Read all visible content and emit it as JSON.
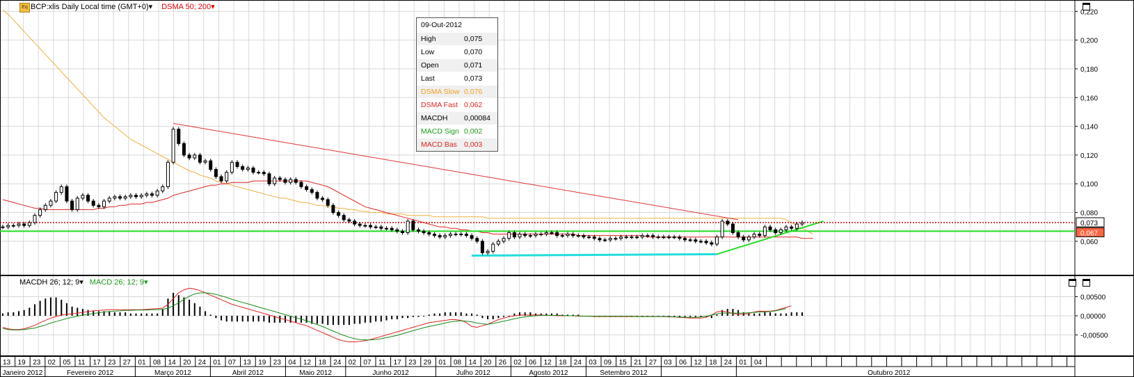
{
  "header": {
    "instrument": "BCP:xlis Daily Local time (GMT+0)",
    "indicator": "DSMA 50; 200",
    "logo_text": "Eq"
  },
  "macd_header": {
    "macdh": "MACDH 26; 12; 9",
    "macd": "MACD 26; 12; 9"
  },
  "infobox": {
    "date": "09-Out-2012",
    "rows": [
      {
        "k": "High",
        "v": "0,075",
        "color": "#000000"
      },
      {
        "k": "Low",
        "v": "0,070",
        "color": "#000000"
      },
      {
        "k": "Open",
        "v": "0,071",
        "color": "#000000"
      },
      {
        "k": "Last",
        "v": "0,073",
        "color": "#000000"
      },
      {
        "k": "DSMA Slow",
        "v": "0,076",
        "color": "#f0a020"
      },
      {
        "k": "DSMA Fast",
        "v": "0,062",
        "color": "#dd2222"
      },
      {
        "k": "MACDH",
        "v": "0,00084",
        "color": "#000000"
      },
      {
        "k": "MACD Sign",
        "v": "0,002",
        "color": "#1a9a1a"
      },
      {
        "k": "MACD Bas",
        "v": "0,003",
        "color": "#dd2222"
      }
    ]
  },
  "colors": {
    "slow_ma": "#f0b040",
    "fast_ma": "#dd2222",
    "support": "#22dd22",
    "low_line": "#22dddd",
    "trendline": "#dd3333",
    "last_price": "#cc0000",
    "support_label_bg": "#ff6644"
  },
  "chart_data": [
    {
      "type": "candlestick",
      "title": "BCP:xlis Daily Local time (GMT+0)",
      "ylim": [
        0.043,
        0.225
      ],
      "y_ticks": [
        "0,060",
        "0,080",
        "0,100",
        "0,120",
        "0,140",
        "0,160",
        "0,180",
        "0,200",
        "0,220"
      ],
      "y_tick_values": [
        0.06,
        0.08,
        0.1,
        0.12,
        0.14,
        0.16,
        0.18,
        0.2,
        0.22
      ],
      "last_price_label": "0,073",
      "last_price": 0.073,
      "support_label": "0,067",
      "support": 0.067,
      "closes": [
        0.07,
        0.071,
        0.071,
        0.072,
        0.071,
        0.073,
        0.078,
        0.082,
        0.085,
        0.088,
        0.094,
        0.098,
        0.088,
        0.082,
        0.09,
        0.092,
        0.088,
        0.085,
        0.084,
        0.088,
        0.09,
        0.091,
        0.09,
        0.091,
        0.092,
        0.091,
        0.092,
        0.093,
        0.092,
        0.095,
        0.098,
        0.115,
        0.138,
        0.128,
        0.12,
        0.118,
        0.12,
        0.115,
        0.116,
        0.11,
        0.105,
        0.102,
        0.108,
        0.115,
        0.112,
        0.11,
        0.111,
        0.108,
        0.108,
        0.107,
        0.1,
        0.104,
        0.103,
        0.101,
        0.103,
        0.101,
        0.098,
        0.096,
        0.094,
        0.09,
        0.089,
        0.085,
        0.08,
        0.078,
        0.075,
        0.074,
        0.072,
        0.071,
        0.071,
        0.07,
        0.07,
        0.069,
        0.069,
        0.068,
        0.067,
        0.066,
        0.074,
        0.068,
        0.067,
        0.066,
        0.065,
        0.064,
        0.063,
        0.064,
        0.065,
        0.065,
        0.065,
        0.064,
        0.062,
        0.06,
        0.052,
        0.053,
        0.058,
        0.06,
        0.062,
        0.066,
        0.063,
        0.065,
        0.064,
        0.064,
        0.065,
        0.065,
        0.066,
        0.066,
        0.064,
        0.064,
        0.065,
        0.064,
        0.064,
        0.063,
        0.063,
        0.062,
        0.061,
        0.061,
        0.062,
        0.062,
        0.063,
        0.063,
        0.063,
        0.063,
        0.064,
        0.064,
        0.063,
        0.063,
        0.063,
        0.063,
        0.063,
        0.062,
        0.061,
        0.061,
        0.06,
        0.06,
        0.059,
        0.058,
        0.063,
        0.074,
        0.072,
        0.066,
        0.063,
        0.061,
        0.063,
        0.065,
        0.064,
        0.07,
        0.068,
        0.066,
        0.068,
        0.07,
        0.069,
        0.072,
        0.073
      ],
      "sma_slow": [
        0.221,
        0.218,
        0.214,
        0.21,
        0.206,
        0.202,
        0.198,
        0.194,
        0.19,
        0.186,
        0.182,
        0.178,
        0.174,
        0.17,
        0.166,
        0.162,
        0.158,
        0.154,
        0.15,
        0.146,
        0.143,
        0.14,
        0.137,
        0.134,
        0.131,
        0.129,
        0.127,
        0.125,
        0.123,
        0.121,
        0.119,
        0.117,
        0.115,
        0.113,
        0.111,
        0.109,
        0.108,
        0.106,
        0.105,
        0.104,
        0.102,
        0.101,
        0.1,
        0.099,
        0.098,
        0.097,
        0.096,
        0.095,
        0.094,
        0.093,
        0.092,
        0.091,
        0.09,
        0.09,
        0.089,
        0.088,
        0.087,
        0.087,
        0.086,
        0.085,
        0.085,
        0.084,
        0.084,
        0.083,
        0.083,
        0.082,
        0.082,
        0.081,
        0.081,
        0.08,
        0.08,
        0.08,
        0.079,
        0.079,
        0.079,
        0.079,
        0.078,
        0.078,
        0.078,
        0.078,
        0.078,
        0.077,
        0.077,
        0.077,
        0.077,
        0.077,
        0.077,
        0.077,
        0.077,
        0.077,
        0.077,
        0.076,
        0.076,
        0.076,
        0.076,
        0.076,
        0.076,
        0.076,
        0.076,
        0.076,
        0.076,
        0.076,
        0.076,
        0.076,
        0.076,
        0.076,
        0.076,
        0.076,
        0.076,
        0.076,
        0.076,
        0.076,
        0.076,
        0.076,
        0.076,
        0.076,
        0.076,
        0.076,
        0.076,
        0.076,
        0.076,
        0.076,
        0.076,
        0.076,
        0.076,
        0.076,
        0.076,
        0.076,
        0.076,
        0.076,
        0.076,
        0.076,
        0.076,
        0.076,
        0.076,
        0.076,
        0.076,
        0.076,
        0.076,
        0.076,
        0.076,
        0.076,
        0.076,
        0.076,
        0.076,
        0.076,
        0.076,
        0.075,
        0.073,
        0.071,
        0.069,
        0.067,
        0.065
      ],
      "sma_fast": [
        0.089,
        0.088,
        0.087,
        0.086,
        0.085,
        0.084,
        0.083,
        0.083,
        0.082,
        0.082,
        0.082,
        0.082,
        0.082,
        0.082,
        0.082,
        0.082,
        0.082,
        0.082,
        0.083,
        0.083,
        0.084,
        0.084,
        0.085,
        0.085,
        0.086,
        0.086,
        0.086,
        0.087,
        0.087,
        0.088,
        0.089,
        0.09,
        0.092,
        0.093,
        0.094,
        0.095,
        0.096,
        0.097,
        0.098,
        0.099,
        0.099,
        0.1,
        0.1,
        0.101,
        0.101,
        0.101,
        0.101,
        0.102,
        0.102,
        0.102,
        0.102,
        0.102,
        0.102,
        0.102,
        0.102,
        0.102,
        0.102,
        0.102,
        0.101,
        0.1,
        0.099,
        0.098,
        0.096,
        0.094,
        0.092,
        0.09,
        0.088,
        0.086,
        0.084,
        0.083,
        0.082,
        0.081,
        0.08,
        0.079,
        0.078,
        0.077,
        0.076,
        0.075,
        0.074,
        0.073,
        0.072,
        0.071,
        0.07,
        0.07,
        0.069,
        0.069,
        0.068,
        0.068,
        0.067,
        0.067,
        0.066,
        0.066,
        0.065,
        0.065,
        0.065,
        0.065,
        0.065,
        0.065,
        0.065,
        0.065,
        0.065,
        0.065,
        0.065,
        0.065,
        0.065,
        0.065,
        0.065,
        0.065,
        0.064,
        0.064,
        0.064,
        0.064,
        0.064,
        0.064,
        0.064,
        0.064,
        0.064,
        0.064,
        0.064,
        0.064,
        0.064,
        0.063,
        0.063,
        0.063,
        0.063,
        0.063,
        0.063,
        0.063,
        0.063,
        0.063,
        0.063,
        0.063,
        0.063,
        0.063,
        0.063,
        0.063,
        0.063,
        0.063,
        0.063,
        0.063,
        0.063,
        0.063,
        0.063,
        0.063,
        0.063,
        0.063,
        0.063,
        0.063,
        0.063,
        0.063,
        0.062,
        0.062,
        0.062
      ]
    },
    {
      "type": "bar",
      "title": "MACDH 26; 12; 9",
      "ylim": [
        -0.0066,
        0.0066
      ],
      "y_ticks": [
        "-0,00500",
        "0,00000",
        "0,00500"
      ],
      "y_tick_values": [
        -0.005,
        0.0,
        0.005
      ],
      "series": [
        {
          "name": "MACDH 26; 12; 9",
          "values": [
            0.0002,
            0.0003,
            0.0003,
            0.0004,
            0.0005,
            0.0007,
            0.001,
            0.0013,
            0.0015,
            0.0016,
            0.0016,
            0.0014,
            0.0011,
            0.0008,
            0.0007,
            0.0006,
            0.0005,
            0.0004,
            0.0004,
            0.0004,
            0.0004,
            0.0003,
            0.0003,
            0.0003,
            0.0002,
            0.0002,
            0.0002,
            0.0002,
            0.0002,
            0.0002,
            0.0006,
            0.0015,
            0.002,
            0.0018,
            0.0016,
            0.0014,
            0.0011,
            0.0008,
            0.0004,
            0.0001,
            -0.0002,
            -0.0004,
            -0.0005,
            -0.0005,
            -0.0005,
            -0.0005,
            -0.0005,
            -0.0005,
            -0.0005,
            -0.0005,
            -0.0006,
            -0.0006,
            -0.0006,
            -0.0006,
            -0.0006,
            -0.0006,
            -0.0006,
            -0.0006,
            -0.0007,
            -0.0007,
            -0.0007,
            -0.0008,
            -0.0008,
            -0.0008,
            -0.0008,
            -0.0008,
            -0.0007,
            -0.0007,
            -0.0006,
            -0.0006,
            -0.0005,
            -0.0005,
            -0.0004,
            -0.0003,
            -0.0003,
            -0.0002,
            -0.0002,
            -0.0001,
            -0.0001,
            0.0,
            0.0001,
            0.0002,
            0.0002,
            0.0003,
            0.0003,
            0.0003,
            0.0003,
            0.0002,
            0.0002,
            0.0001,
            -0.0002,
            -0.0003,
            -0.0003,
            -0.0002,
            -0.0001,
            0.0,
            0.0002,
            0.0003,
            0.0003,
            0.0003,
            0.0002,
            0.0002,
            0.0002,
            0.0002,
            0.0002,
            0.0001,
            0.0001,
            0.0001,
            0.0001,
            0.0,
            0.0,
            -0.0001,
            -0.0001,
            -0.0001,
            -0.0001,
            -0.0001,
            -0.0001,
            -0.0001,
            -0.0001,
            -0.0001,
            -0.0001,
            0.0,
            0.0,
            0.0,
            0.0,
            0.0,
            0.0,
            -0.0001,
            -0.0001,
            -0.0001,
            -0.0001,
            -0.0001,
            -0.0001,
            -0.0002,
            0.0001,
            0.0005,
            0.0006,
            0.0006,
            0.0005,
            0.0003,
            0.0002,
            0.0002,
            0.0002,
            0.0003,
            0.0003,
            0.0002,
            0.0002,
            0.0002,
            0.0003,
            0.0003,
            0.0003
          ]
        },
        {
          "name": "MACD 26; 12; 9",
          "values": [
            -0.003,
            -0.0034,
            -0.0036,
            -0.0036,
            -0.0034,
            -0.003,
            -0.0025,
            -0.0018,
            -0.0012,
            -0.0006,
            -0.0002,
            0.0002,
            0.0004,
            0.0005,
            0.0007,
            0.0009,
            0.0011,
            0.0013,
            0.0014,
            0.0015,
            0.0016,
            0.0016,
            0.0016,
            0.0016,
            0.0016,
            0.0016,
            0.0016,
            0.0017,
            0.0018,
            0.0019,
            0.002,
            0.003,
            0.0045,
            0.006,
            0.0068,
            0.0072,
            0.007,
            0.0066,
            0.006,
            0.0054,
            0.0048,
            0.0042,
            0.0036,
            0.003,
            0.0026,
            0.0022,
            0.0018,
            0.0014,
            0.001,
            0.0006,
            0.0002,
            -0.0002,
            -0.0006,
            -0.001,
            -0.0014,
            -0.0018,
            -0.0022,
            -0.0026,
            -0.0032,
            -0.0038,
            -0.0044,
            -0.005,
            -0.0056,
            -0.0062,
            -0.0066,
            -0.0068,
            -0.0068,
            -0.0067,
            -0.0065,
            -0.0062,
            -0.0058,
            -0.0054,
            -0.005,
            -0.0046,
            -0.0042,
            -0.0038,
            -0.0034,
            -0.003,
            -0.0026,
            -0.0022,
            -0.0018,
            -0.0016,
            -0.0014,
            -0.0012,
            -0.001,
            -0.001,
            -0.0012,
            -0.0018,
            -0.0028,
            -0.003,
            -0.0026,
            -0.0022,
            -0.0016,
            -0.001,
            -0.0006,
            -0.0002,
            0.0,
            0.0002,
            0.0002,
            0.0002,
            0.0002,
            0.0002,
            0.0001,
            0.0001,
            0.0,
            0.0,
            0.0,
            0.0,
            -0.0001,
            -0.0001,
            -0.0001,
            -0.0002,
            -0.0002,
            -0.0002,
            -0.0002,
            -0.0002,
            -0.0002,
            -0.0002,
            -0.0002,
            -0.0002,
            -0.0002,
            -0.0002,
            -0.0002,
            -0.0002,
            -0.0002,
            -0.0003,
            -0.0003,
            -0.0004,
            -0.0005,
            -0.0006,
            -0.0006,
            -0.0006,
            -0.0004,
            0.0002,
            0.001,
            0.0012,
            0.001,
            0.0006,
            0.0004,
            0.0004,
            0.0006,
            0.001,
            0.0012,
            0.0012,
            0.0012,
            0.0014,
            0.0018,
            0.0022,
            0.0026
          ]
        },
        {
          "name": "MACD Sign",
          "values": [
            -0.0033,
            -0.0036,
            -0.0037,
            -0.0037,
            -0.0036,
            -0.0034,
            -0.0032,
            -0.0028,
            -0.0024,
            -0.0019,
            -0.0015,
            -0.0011,
            -0.0007,
            -0.0004,
            -0.0001,
            0.0002,
            0.0004,
            0.0006,
            0.0008,
            0.001,
            0.0011,
            0.0012,
            0.0013,
            0.0014,
            0.0014,
            0.0015,
            0.0015,
            0.0015,
            0.0016,
            0.0016,
            0.0017,
            0.002,
            0.0026,
            0.0034,
            0.0043,
            0.0051,
            0.0057,
            0.006,
            0.006,
            0.0059,
            0.0056,
            0.0052,
            0.0048,
            0.0043,
            0.0039,
            0.0035,
            0.0031,
            0.0027,
            0.0023,
            0.0019,
            0.0015,
            0.0011,
            0.0007,
            0.0003,
            -0.0001,
            -0.0005,
            -0.0009,
            -0.0013,
            -0.0018,
            -0.0023,
            -0.0028,
            -0.0034,
            -0.004,
            -0.0046,
            -0.0051,
            -0.0056,
            -0.006,
            -0.0062,
            -0.0063,
            -0.0063,
            -0.0062,
            -0.006,
            -0.0057,
            -0.0054,
            -0.0051,
            -0.0047,
            -0.0043,
            -0.0039,
            -0.0035,
            -0.0031,
            -0.0028,
            -0.0025,
            -0.0022,
            -0.0019,
            -0.0016,
            -0.0014,
            -0.0013,
            -0.0014,
            -0.0016,
            -0.0019,
            -0.0021,
            -0.0022,
            -0.002,
            -0.0017,
            -0.0014,
            -0.0011,
            -0.0008,
            -0.0005,
            -0.0003,
            -0.0001,
            0.0,
            0.0001,
            0.0001,
            0.0001,
            0.0001,
            0.0001,
            0.0,
            0.0,
            0.0,
            -0.0001,
            -0.0001,
            -0.0001,
            -0.0001,
            -0.0001,
            -0.0001,
            -0.0001,
            -0.0001,
            -0.0001,
            -0.0001,
            -0.0002,
            -0.0002,
            -0.0002,
            -0.0002,
            -0.0002,
            -0.0002,
            -0.0002,
            -0.0003,
            -0.0003,
            -0.0004,
            -0.0004,
            -0.0004,
            -0.0003,
            -0.0001,
            0.0002,
            0.0005,
            0.0007,
            0.0007,
            0.0007,
            0.0007,
            0.0007,
            0.0008,
            0.0009,
            0.001,
            0.001,
            0.0011,
            0.0013,
            0.0016,
            0.0019
          ]
        }
      ]
    }
  ],
  "x_axis": {
    "days": [
      "13",
      "19",
      "23",
      "02",
      "05",
      "11",
      "17",
      "23",
      "27",
      "01",
      "08",
      "14",
      "20",
      "24",
      "01",
      "07",
      "13",
      "19",
      "23",
      "04",
      "12",
      "18",
      "24",
      "02",
      "07",
      "11",
      "17",
      "23",
      "29",
      "01",
      "08",
      "14",
      "20",
      "26",
      "02",
      "06",
      "12",
      "18",
      "24",
      "03",
      "09",
      "15",
      "21",
      "27",
      "03",
      "06",
      "12",
      "18",
      "24",
      "01",
      "04"
    ],
    "months": [
      "Janeiro 2012",
      "Fevereiro 2012",
      "Março 2012",
      "Abril 2012",
      "Maio 2012",
      "Junho 2012",
      "Julho 2012",
      "Agosto 2012",
      "Setembro 2012",
      "Outubro 2012"
    ]
  }
}
